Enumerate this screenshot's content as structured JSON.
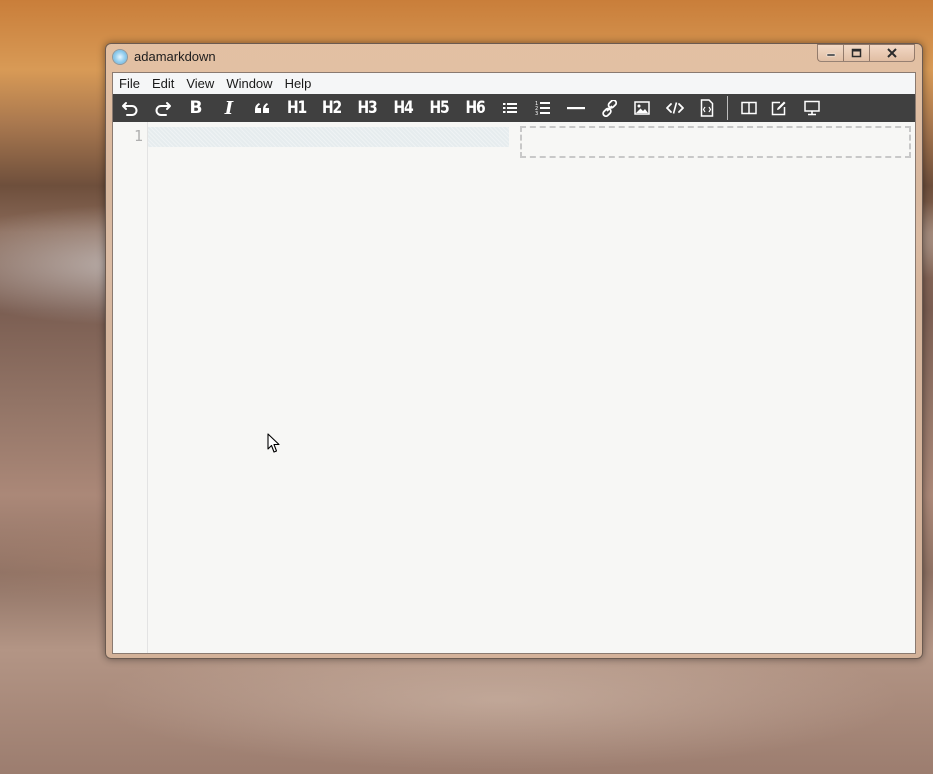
{
  "window": {
    "title": "adamarkdown",
    "app_icon": "electron-atom-icon",
    "caption_buttons": [
      "minimize-icon",
      "maximize-icon",
      "close-icon"
    ]
  },
  "menubar": {
    "items": [
      "File",
      "Edit",
      "View",
      "Window",
      "Help"
    ]
  },
  "toolbar": {
    "buttons": [
      {
        "name": "undo",
        "icon": "undo-icon"
      },
      {
        "name": "redo",
        "icon": "redo-icon"
      },
      {
        "name": "bold",
        "label": "B"
      },
      {
        "name": "italic",
        "label": "I"
      },
      {
        "name": "quote",
        "icon": "quote-icon"
      },
      {
        "name": "h1",
        "label": "H1"
      },
      {
        "name": "h2",
        "label": "H2"
      },
      {
        "name": "h3",
        "label": "H3"
      },
      {
        "name": "h4",
        "label": "H4"
      },
      {
        "name": "h5",
        "label": "H5"
      },
      {
        "name": "h6",
        "label": "H6"
      },
      {
        "name": "unordered-list",
        "icon": "list-ul-icon"
      },
      {
        "name": "ordered-list",
        "icon": "list-ol-icon"
      },
      {
        "name": "horizontal-rule",
        "icon": "hr-icon"
      },
      {
        "name": "link",
        "icon": "link-icon"
      },
      {
        "name": "image",
        "icon": "image-icon"
      },
      {
        "name": "code",
        "icon": "code-icon"
      },
      {
        "name": "code-file",
        "icon": "code-file-icon"
      },
      {
        "name": "split-view",
        "icon": "columns-icon"
      },
      {
        "name": "edit-mode",
        "icon": "edit-icon"
      },
      {
        "name": "preview-mode",
        "icon": "desktop-icon"
      }
    ]
  },
  "editor": {
    "line_numbers": [
      "1"
    ],
    "content": ""
  },
  "colors": {
    "toolbar_bg": "#404040",
    "editor_bg": "#f7f7f5",
    "active_line": "#e6ecee",
    "preview_border": "#c8c8c8"
  }
}
